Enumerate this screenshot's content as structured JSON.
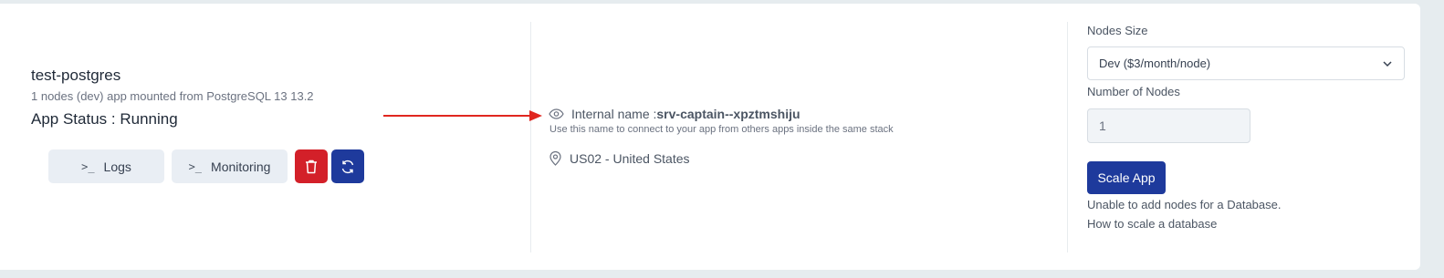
{
  "app": {
    "name": "test-postgres",
    "subtitle": "1 nodes (dev) app mounted from PostgreSQL 13 13.2",
    "status": "App Status : Running"
  },
  "actions": {
    "logs_label": "Logs",
    "monitoring_label": "Monitoring",
    "delete_icon": "trash-icon",
    "refresh_icon": "refresh-icon"
  },
  "info": {
    "internal_name_label": "Internal name :",
    "internal_name_value": "srv-captain--xpztmshiju",
    "hint": "Use this name to connect to your app from others apps inside the same stack",
    "location": "US02 - United States"
  },
  "scaling": {
    "nodes_size_label": "Nodes Size",
    "nodes_size_value": "Dev ($3/month/node)",
    "number_of_nodes_label": "Number of Nodes",
    "number_of_nodes_value": "1",
    "scale_button": "Scale App",
    "warning": "Unable to add nodes for a Database.",
    "help_link": "How to scale a database"
  },
  "colors": {
    "accent": "#1e3a9c",
    "danger": "#d32029",
    "arrow": "#e0261f"
  }
}
